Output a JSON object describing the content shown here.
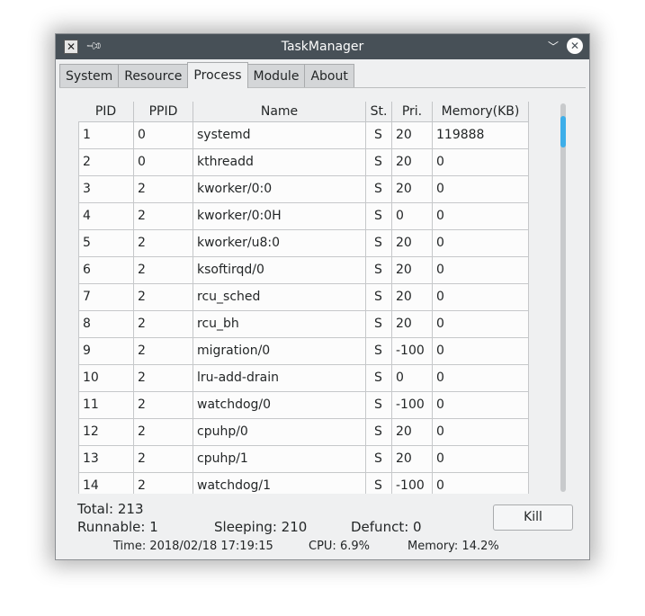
{
  "window": {
    "title": "TaskManager"
  },
  "tabs": [
    {
      "label": "System"
    },
    {
      "label": "Resource"
    },
    {
      "label": "Process"
    },
    {
      "label": "Module"
    },
    {
      "label": "About"
    }
  ],
  "active_tab": "Process",
  "table": {
    "headers": [
      "PID",
      "PPID",
      "Name",
      "St.",
      "Pri.",
      "Memory(KB)"
    ],
    "rows": [
      [
        "1",
        "0",
        "systemd",
        "S",
        "20",
        "119888"
      ],
      [
        "2",
        "0",
        "kthreadd",
        "S",
        "20",
        "0"
      ],
      [
        "3",
        "2",
        "kworker/0:0",
        "S",
        "20",
        "0"
      ],
      [
        "4",
        "2",
        "kworker/0:0H",
        "S",
        "0",
        "0"
      ],
      [
        "5",
        "2",
        "kworker/u8:0",
        "S",
        "20",
        "0"
      ],
      [
        "6",
        "2",
        "ksoftirqd/0",
        "S",
        "20",
        "0"
      ],
      [
        "7",
        "2",
        "rcu_sched",
        "S",
        "20",
        "0"
      ],
      [
        "8",
        "2",
        "rcu_bh",
        "S",
        "20",
        "0"
      ],
      [
        "9",
        "2",
        "migration/0",
        "S",
        "-100",
        "0"
      ],
      [
        "10",
        "2",
        "lru-add-drain",
        "S",
        "0",
        "0"
      ],
      [
        "11",
        "2",
        "watchdog/0",
        "S",
        "-100",
        "0"
      ],
      [
        "12",
        "2",
        "cpuhp/0",
        "S",
        "20",
        "0"
      ],
      [
        "13",
        "2",
        "cpuhp/1",
        "S",
        "20",
        "0"
      ],
      [
        "14",
        "2",
        "watchdog/1",
        "S",
        "-100",
        "0"
      ]
    ]
  },
  "stats": {
    "total": "Total: 213",
    "runnable": "Runnable: 1",
    "sleeping": "Sleeping: 210",
    "defunct": "Defunct: 0"
  },
  "kill_label": "Kill",
  "status": {
    "time": "Time: 2018/02/18 17:19:15",
    "cpu": "CPU: 6.9%",
    "memory": "Memory: 14.2%"
  },
  "colors": {
    "accent": "#3daee9",
    "titlebar": "#475057"
  },
  "icons": {
    "app": "x-app-icon",
    "pin": "pin-icon",
    "minimize": "chevron-down-icon",
    "close": "close-icon"
  }
}
